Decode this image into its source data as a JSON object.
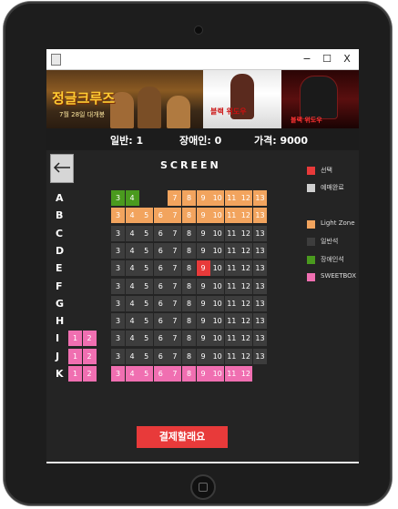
{
  "window": {
    "minimize_label": "−",
    "maximize_label": "☐",
    "close_label": "X"
  },
  "banner": {
    "posters": [
      {
        "title": "정글크루즈",
        "caption": "7월 28일 대개봉"
      },
      {
        "title": "블랙 위도우",
        "caption": ""
      },
      {
        "title": "블랙 위도우",
        "caption": ""
      }
    ]
  },
  "info": {
    "general": "일반: 1",
    "disabled": "장애인: 0",
    "price": "가격: 9000"
  },
  "screen_label": "SCREEN",
  "rows": [
    {
      "label": "A",
      "seats": [
        {
          "n": "3",
          "t": "disabled"
        },
        {
          "n": "4",
          "t": "disabled"
        },
        {
          "n": "7",
          "t": "light"
        },
        {
          "n": "8",
          "t": "light"
        },
        {
          "n": "9",
          "t": "light"
        },
        {
          "n": "10",
          "t": "light"
        },
        {
          "n": "11",
          "t": "light"
        },
        {
          "n": "12",
          "t": "light"
        },
        {
          "n": "13",
          "t": "light"
        }
      ]
    },
    {
      "label": "B",
      "seats": [
        {
          "n": "3",
          "t": "light"
        },
        {
          "n": "4",
          "t": "light"
        },
        {
          "n": "5",
          "t": "light"
        },
        {
          "n": "6",
          "t": "light"
        },
        {
          "n": "7",
          "t": "light"
        },
        {
          "n": "8",
          "t": "light"
        },
        {
          "n": "9",
          "t": "light"
        },
        {
          "n": "10",
          "t": "light"
        },
        {
          "n": "11",
          "t": "light"
        },
        {
          "n": "12",
          "t": "light"
        },
        {
          "n": "13",
          "t": "light"
        }
      ]
    },
    {
      "label": "C",
      "seats": [
        {
          "n": "3",
          "t": "avail"
        },
        {
          "n": "4",
          "t": "avail"
        },
        {
          "n": "5",
          "t": "avail"
        },
        {
          "n": "6",
          "t": "avail"
        },
        {
          "n": "7",
          "t": "avail"
        },
        {
          "n": "8",
          "t": "avail"
        },
        {
          "n": "9",
          "t": "avail"
        },
        {
          "n": "10",
          "t": "avail"
        },
        {
          "n": "11",
          "t": "avail"
        },
        {
          "n": "12",
          "t": "avail"
        },
        {
          "n": "13",
          "t": "avail"
        }
      ]
    },
    {
      "label": "D",
      "seats": [
        {
          "n": "3",
          "t": "avail"
        },
        {
          "n": "4",
          "t": "avail"
        },
        {
          "n": "5",
          "t": "avail"
        },
        {
          "n": "6",
          "t": "avail"
        },
        {
          "n": "7",
          "t": "avail"
        },
        {
          "n": "8",
          "t": "avail"
        },
        {
          "n": "9",
          "t": "avail"
        },
        {
          "n": "10",
          "t": "avail"
        },
        {
          "n": "11",
          "t": "avail"
        },
        {
          "n": "12",
          "t": "avail"
        },
        {
          "n": "13",
          "t": "avail"
        }
      ]
    },
    {
      "label": "E",
      "seats": [
        {
          "n": "3",
          "t": "avail"
        },
        {
          "n": "4",
          "t": "avail"
        },
        {
          "n": "5",
          "t": "avail"
        },
        {
          "n": "6",
          "t": "avail"
        },
        {
          "n": "7",
          "t": "avail"
        },
        {
          "n": "8",
          "t": "avail"
        },
        {
          "n": "9",
          "t": "selected"
        },
        {
          "n": "10",
          "t": "avail"
        },
        {
          "n": "11",
          "t": "avail"
        },
        {
          "n": "12",
          "t": "avail"
        },
        {
          "n": "13",
          "t": "avail"
        }
      ]
    },
    {
      "label": "F",
      "seats": [
        {
          "n": "3",
          "t": "avail"
        },
        {
          "n": "4",
          "t": "avail"
        },
        {
          "n": "5",
          "t": "avail"
        },
        {
          "n": "6",
          "t": "avail"
        },
        {
          "n": "7",
          "t": "avail"
        },
        {
          "n": "8",
          "t": "avail"
        },
        {
          "n": "9",
          "t": "avail"
        },
        {
          "n": "10",
          "t": "avail"
        },
        {
          "n": "11",
          "t": "avail"
        },
        {
          "n": "12",
          "t": "avail"
        },
        {
          "n": "13",
          "t": "avail"
        }
      ]
    },
    {
      "label": "G",
      "seats": [
        {
          "n": "3",
          "t": "avail"
        },
        {
          "n": "4",
          "t": "avail"
        },
        {
          "n": "5",
          "t": "avail"
        },
        {
          "n": "6",
          "t": "avail"
        },
        {
          "n": "7",
          "t": "avail"
        },
        {
          "n": "8",
          "t": "avail"
        },
        {
          "n": "9",
          "t": "avail"
        },
        {
          "n": "10",
          "t": "avail"
        },
        {
          "n": "11",
          "t": "avail"
        },
        {
          "n": "12",
          "t": "avail"
        },
        {
          "n": "13",
          "t": "avail"
        }
      ]
    },
    {
      "label": "H",
      "seats": [
        {
          "n": "3",
          "t": "avail"
        },
        {
          "n": "4",
          "t": "avail"
        },
        {
          "n": "5",
          "t": "avail"
        },
        {
          "n": "6",
          "t": "avail"
        },
        {
          "n": "7",
          "t": "avail"
        },
        {
          "n": "8",
          "t": "avail"
        },
        {
          "n": "9",
          "t": "avail"
        },
        {
          "n": "10",
          "t": "avail"
        },
        {
          "n": "11",
          "t": "avail"
        },
        {
          "n": "12",
          "t": "avail"
        },
        {
          "n": "13",
          "t": "avail"
        }
      ]
    },
    {
      "label": "I",
      "seats": [
        {
          "n": "1",
          "t": "sweet"
        },
        {
          "n": "2",
          "t": "sweet"
        },
        {
          "n": "3",
          "t": "avail"
        },
        {
          "n": "4",
          "t": "avail"
        },
        {
          "n": "5",
          "t": "avail"
        },
        {
          "n": "6",
          "t": "avail"
        },
        {
          "n": "7",
          "t": "avail"
        },
        {
          "n": "8",
          "t": "avail"
        },
        {
          "n": "9",
          "t": "avail"
        },
        {
          "n": "10",
          "t": "avail"
        },
        {
          "n": "11",
          "t": "avail"
        },
        {
          "n": "12",
          "t": "avail"
        },
        {
          "n": "13",
          "t": "avail"
        }
      ]
    },
    {
      "label": "J",
      "seats": [
        {
          "n": "1",
          "t": "sweet"
        },
        {
          "n": "2",
          "t": "sweet"
        },
        {
          "n": "3",
          "t": "avail"
        },
        {
          "n": "4",
          "t": "avail"
        },
        {
          "n": "5",
          "t": "avail"
        },
        {
          "n": "6",
          "t": "avail"
        },
        {
          "n": "7",
          "t": "avail"
        },
        {
          "n": "8",
          "t": "avail"
        },
        {
          "n": "9",
          "t": "avail"
        },
        {
          "n": "10",
          "t": "avail"
        },
        {
          "n": "11",
          "t": "avail"
        },
        {
          "n": "12",
          "t": "avail"
        },
        {
          "n": "13",
          "t": "avail"
        }
      ]
    },
    {
      "label": "K",
      "seats": [
        {
          "n": "1",
          "t": "sweet"
        },
        {
          "n": "2",
          "t": "sweet"
        },
        {
          "n": "3",
          "t": "sweet"
        },
        {
          "n": "4",
          "t": "sweet"
        },
        {
          "n": "5",
          "t": "sweet"
        },
        {
          "n": "6",
          "t": "sweet"
        },
        {
          "n": "7",
          "t": "sweet"
        },
        {
          "n": "8",
          "t": "sweet"
        },
        {
          "n": "9",
          "t": "sweet"
        },
        {
          "n": "10",
          "t": "sweet"
        },
        {
          "n": "11",
          "t": "sweet"
        },
        {
          "n": "12",
          "t": "sweet"
        }
      ]
    }
  ],
  "legend": [
    {
      "label": "선택",
      "color": "#e83a3a"
    },
    {
      "label": "예매완료",
      "color": "#cfcfcf"
    },
    {
      "label": "Light Zone",
      "color": "#f2a45e"
    },
    {
      "label": "일반석",
      "color": "#3d3d3d"
    },
    {
      "label": "장애인석",
      "color": "#4a9a1e"
    },
    {
      "label": "SWEETBOX",
      "color": "#f06fb1"
    }
  ],
  "pay_button": "결제할래요"
}
